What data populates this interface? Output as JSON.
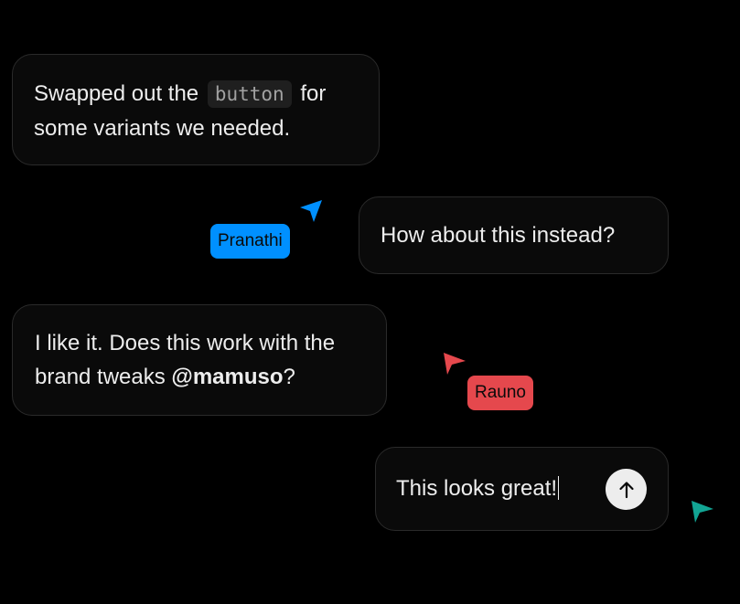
{
  "messages": [
    {
      "text_before": "Swapped out the ",
      "code": "button",
      "text_after": " for some variants we needed."
    },
    {
      "text": "How about this instead?"
    },
    {
      "text_before": "I like it. Does this work with the brand tweaks ",
      "mention": "@mamuso",
      "text_after": "?"
    }
  ],
  "composer": {
    "value": "This looks great!",
    "send_icon": "arrow-up-icon"
  },
  "cursors": [
    {
      "name": "Pranathi",
      "color": "#0090ff",
      "icon": "pointer-cursor-icon"
    },
    {
      "name": "Rauno",
      "color": "#e5484d",
      "icon": "pointer-cursor-icon"
    },
    {
      "name": "",
      "color": "#12a594",
      "icon": "pointer-cursor-icon"
    }
  ],
  "colors": {
    "background": "#000000",
    "bubble": "#0a0a0a",
    "bubble_border": "#2a2a2a",
    "text": "#ededed",
    "code_bg": "#1f1f1f"
  }
}
